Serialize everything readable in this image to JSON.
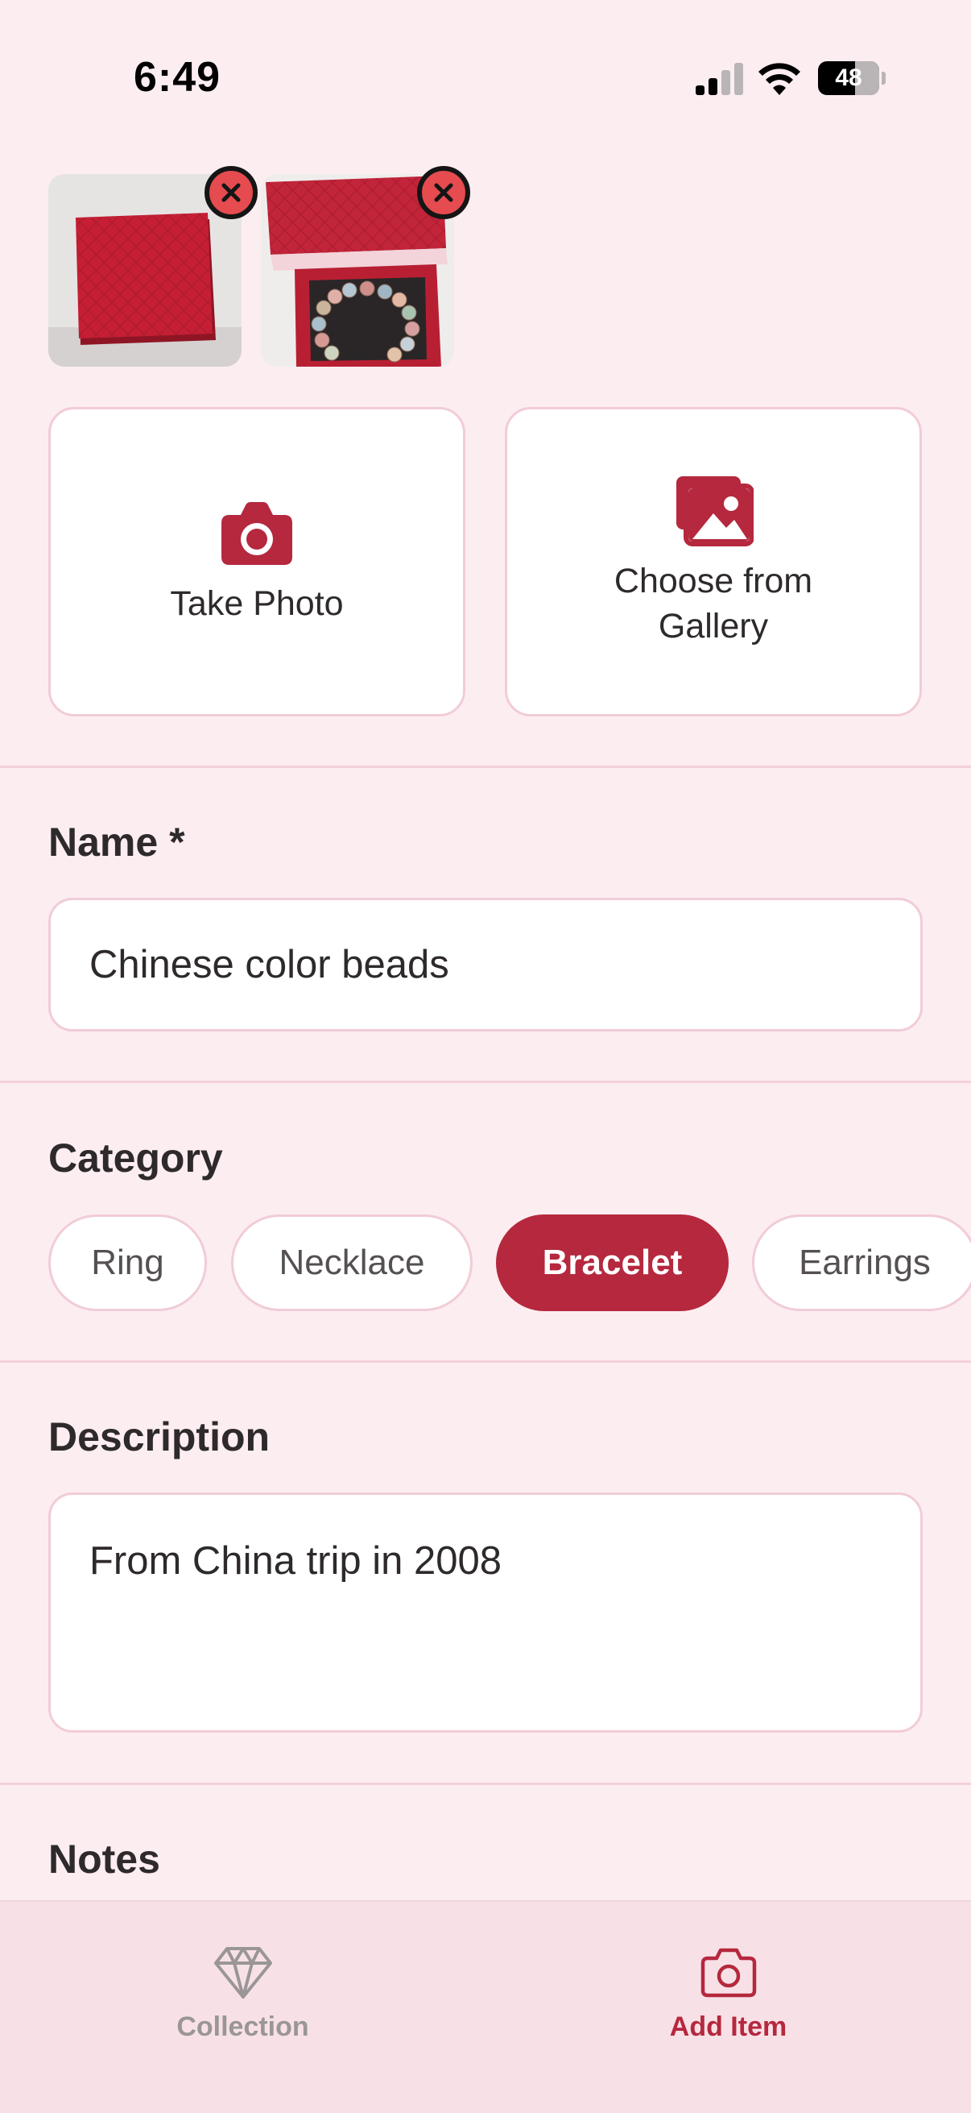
{
  "status_bar": {
    "time": "6:49",
    "battery": "48"
  },
  "photos": [
    {
      "name": "red-gift-box-closed"
    },
    {
      "name": "gift-box-open-with-bracelet"
    }
  ],
  "photo_sources": {
    "take_photo": "Take Photo",
    "gallery_line1": "Choose from",
    "gallery_line2": "Gallery"
  },
  "form": {
    "name_label": "Name *",
    "name_value": "Chinese color beads",
    "category_label": "Category",
    "categories": [
      {
        "label": "Ring",
        "selected": false
      },
      {
        "label": "Necklace",
        "selected": false
      },
      {
        "label": "Bracelet",
        "selected": true
      },
      {
        "label": "Earrings",
        "selected": false
      }
    ],
    "description_label": "Description",
    "description_value": "From China trip in 2008",
    "notes_label": "Notes"
  },
  "tab_bar": {
    "collection": "Collection",
    "add_item": "Add Item"
  },
  "colors": {
    "accent": "#b5283e",
    "background": "#fcedf1",
    "remove_badge": "#e54b4f"
  }
}
